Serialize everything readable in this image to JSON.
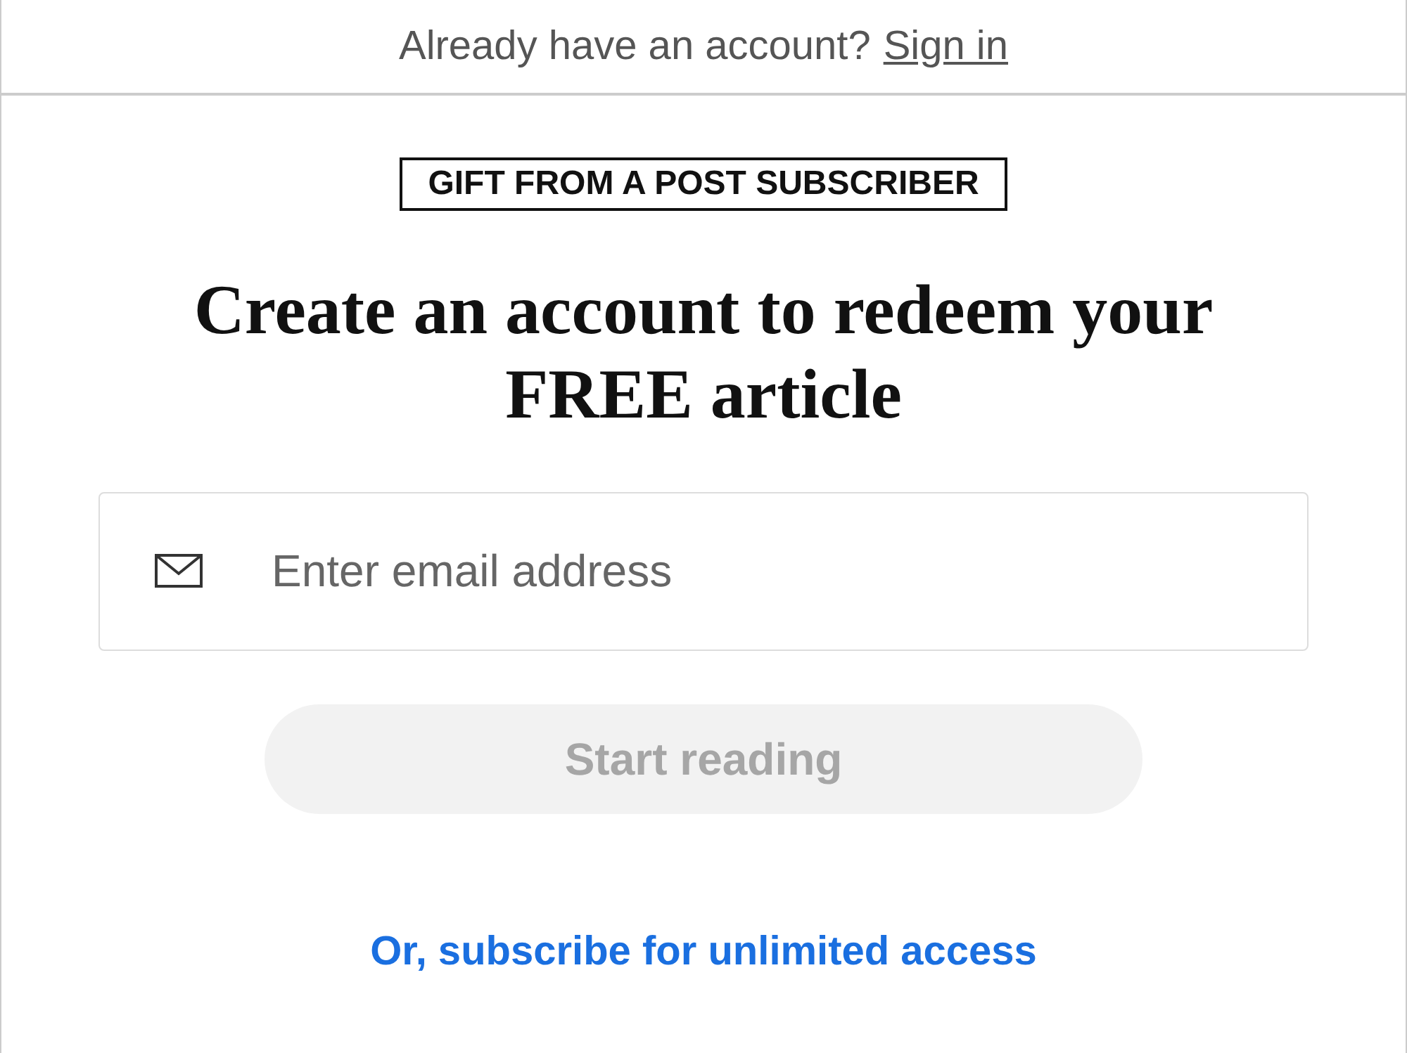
{
  "header": {
    "prompt": "Already have an account?",
    "link": "Sign in"
  },
  "badge": "GIFT FROM A POST SUBSCRIBER",
  "heading": "Create an account to redeem your FREE article",
  "email_field": {
    "placeholder": "Enter email address"
  },
  "submit_button": {
    "label": "Start reading",
    "disabled": true
  },
  "subscribe_link": "Or, subscribe for unlimited access"
}
